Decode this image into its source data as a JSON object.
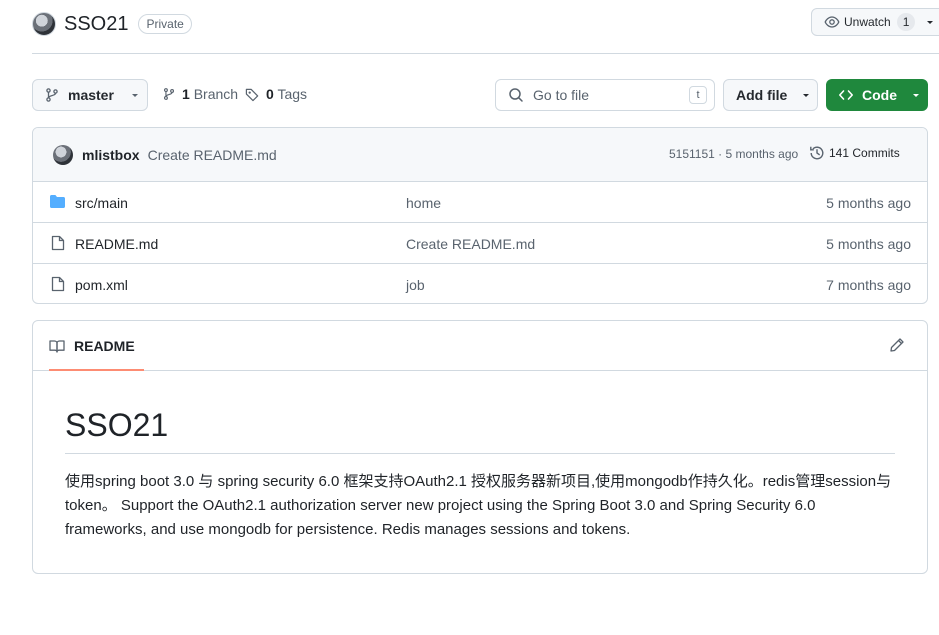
{
  "repo": {
    "name": "SSO21",
    "visibility": "Private"
  },
  "watch": {
    "label": "Unwatch",
    "count": "1"
  },
  "toolbar": {
    "branch": "master",
    "branch_count": "1",
    "branch_label": "Branch",
    "tag_count": "0",
    "tag_label": "Tags",
    "search_placeholder": "Go to file",
    "search_shortcut": "t",
    "add_file_label": "Add file",
    "code_label": "Code"
  },
  "latest_commit": {
    "author": "mlistbox",
    "message": "Create README.md",
    "meta": "5151151 · 5 months ago",
    "commits_label": "141 Commits"
  },
  "files": [
    {
      "type": "folder",
      "name": "src/main",
      "commit": "home",
      "age": "5 months ago"
    },
    {
      "type": "file",
      "name": "README.md",
      "commit": "Create README.md",
      "age": "5 months ago"
    },
    {
      "type": "file",
      "name": "pom.xml",
      "commit": "job",
      "age": "7 months ago"
    }
  ],
  "readme": {
    "tab_label": "README",
    "heading": "SSO21",
    "body": "使用spring boot 3.0 与 spring security 6.0 框架支持OAuth2.1 授权服务器新项目,使用mongodb作持久化。redis管理session与token。 Support the OAuth2.1 authorization server new project using the Spring Boot 3.0 and Spring Security 6.0 frameworks, and use mongodb for persistence. Redis manages sessions and tokens."
  },
  "colors": {
    "accent_green": "#1f883d",
    "folder_blue": "#54aeff",
    "tab_underline": "#fd8c73",
    "border": "#d1d9e0"
  }
}
